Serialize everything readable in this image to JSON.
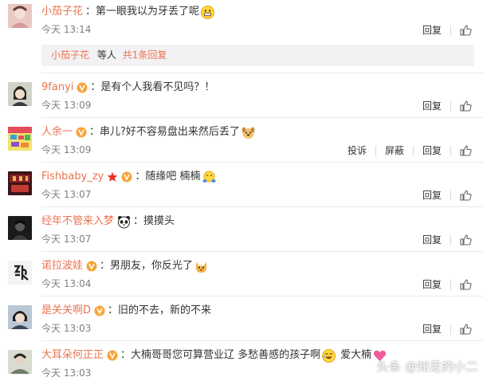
{
  "colors": {
    "username": "#eb7350",
    "text": "#333333",
    "time": "#808080",
    "reply_bg": "#f2f2f5"
  },
  "comments": [
    {
      "username": "小茄子花",
      "badge": "none",
      "text": "第一眼我以为牙丢了呢",
      "emoji": "grinning-face",
      "time": "今天 13:14",
      "actions": [
        "回复"
      ],
      "likes": ""
    },
    {
      "username": "9fanyi",
      "badge": "orange-vip-icon",
      "text": "是有个人我看不见吗？！",
      "emoji": "",
      "time": "今天 13:09",
      "actions": [
        "回复"
      ],
      "likes": ""
    },
    {
      "username": "人余一",
      "badge": "orange-vip-icon",
      "text": "串儿?好不容易盘出来然后丢了",
      "emoji": "dog-face",
      "time": "今天 13:09",
      "actions": [
        "投诉",
        "屏蔽",
        "回复"
      ],
      "likes": ""
    },
    {
      "username": "Fishbaby_zy",
      "badge": "red-star-and-vip-icon",
      "text": "随缘吧 楠楠",
      "emoji": "hugging-face",
      "time": "今天 13:07",
      "actions": [
        "回复"
      ],
      "likes": ""
    },
    {
      "username": "经年不管来入梦",
      "badge": "panda-icon",
      "text": "摸摸头",
      "emoji": "",
      "time": "今天 13:07",
      "actions": [
        "回复"
      ],
      "likes": ""
    },
    {
      "username": "诺拉波娃",
      "badge": "orange-vip-icon",
      "text": "男朋友，你反光了",
      "emoji": "cat-face",
      "time": "今天 13:04",
      "actions": [
        "回复"
      ],
      "likes": ""
    },
    {
      "username": "是关关啊D",
      "badge": "orange-vip-icon",
      "text": "旧的不去，新的不来",
      "emoji": "",
      "time": "今天 13:03",
      "actions": [
        "回复"
      ],
      "likes": ""
    },
    {
      "username": "大耳朵何正正",
      "badge": "orange-vip-icon",
      "text": "大楠哥哥您可算营业辽 多愁善感的孩子啊",
      "emoji": "laughing-face",
      "text2": "爱大楠",
      "emoji2": "pink-heart",
      "time": "今天 13:03",
      "actions": [
        "回复"
      ],
      "likes": ""
    }
  ],
  "reply_summary": {
    "name": "小茄子花",
    "mid": "等人",
    "count": "共1条回复"
  },
  "watermark": "头条 @知足的小二"
}
